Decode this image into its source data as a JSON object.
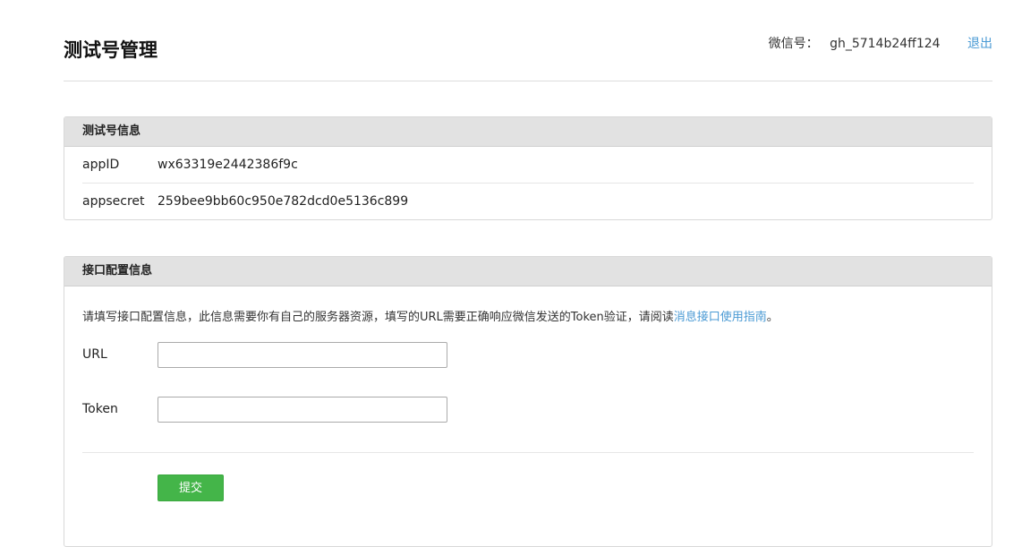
{
  "header": {
    "title": "测试号管理",
    "account_label": "微信号：",
    "account_value": "gh_5714b24ff124",
    "logout_label": "退出"
  },
  "test_account": {
    "title": "测试号信息",
    "rows": [
      {
        "key": "appID",
        "value": "wx63319e2442386f9c"
      },
      {
        "key": "appsecret",
        "value": "259bee9bb60c950e782dcd0e5136c899"
      }
    ]
  },
  "interface": {
    "title": "接口配置信息",
    "notice_text": "请填写接口配置信息，此信息需要你有自己的服务器资源，填写的URL需要正确响应微信发送的Token验证，请阅读",
    "notice_link": "消息接口使用指南",
    "notice_end": "。",
    "url_label": "URL",
    "url_value": "",
    "token_label": "Token",
    "token_value": "",
    "submit_label": "提交"
  },
  "colors": {
    "accent_link": "#4a9ad4",
    "submit_green": "#44b549",
    "panel_header": "#e2e2e2"
  }
}
